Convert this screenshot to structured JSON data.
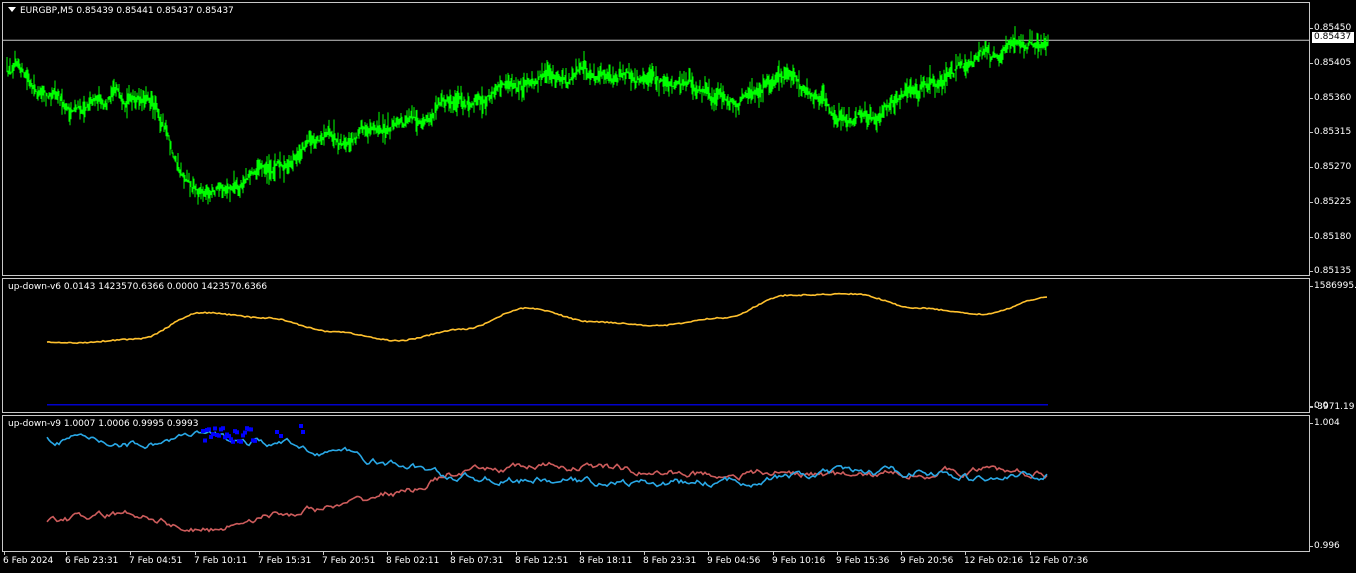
{
  "main_pane": {
    "symbol_label": "EURGBP,M5  0.85439 0.85441 0.85437 0.85437",
    "collapse_icon": "triangle-down-icon",
    "current_price_tag": "0.85437",
    "price_axis": [
      "0.85450",
      "0.85405",
      "0.85360",
      "0.85315",
      "0.85270",
      "0.85225",
      "0.85180",
      "0.85135"
    ],
    "colors": {
      "candles": "#00ff00",
      "price_line": "#c8c8c8"
    }
  },
  "indicator_1": {
    "label": "up-down-v6 0.0143 1423570.6366 0.0000 1423570.6366",
    "axis": [
      "1586995.0",
      "0.0",
      "-3971.19"
    ],
    "colors": {
      "line_main": "#ffc12e",
      "line_base": "#0000cc"
    }
  },
  "indicator_2": {
    "label": "up-down-v9 1.0007 1.0006 0.9995 0.9993",
    "axis": [
      "1.004",
      "0.996"
    ],
    "colors": {
      "line_blue": "#29a8e6",
      "line_red": "#cd5c5c",
      "markers": "#0000ff"
    }
  },
  "time_axis": [
    "6 Feb 2024",
    "6 Feb 23:31",
    "7 Feb 04:51",
    "7 Feb 10:11",
    "7 Feb 15:31",
    "7 Feb 20:51",
    "8 Feb 02:11",
    "8 Feb 07:31",
    "8 Feb 12:51",
    "8 Feb 18:11",
    "8 Feb 23:31",
    "9 Feb 04:56",
    "9 Feb 10:16",
    "9 Feb 15:36",
    "9 Feb 20:56",
    "12 Feb 02:16",
    "12 Feb 07:36"
  ],
  "chart_data": [
    {
      "type": "line",
      "title": "EURGBP,M5",
      "xlabel": "",
      "ylabel": "",
      "ylim": [
        0.85135,
        0.85465
      ],
      "x": [
        "6 Feb 2024",
        "6 Feb 23:31",
        "7 Feb 04:51",
        "7 Feb 10:11",
        "7 Feb 15:31",
        "7 Feb 20:51",
        "8 Feb 02:11",
        "8 Feb 07:31",
        "8 Feb 12:51",
        "8 Feb 18:11",
        "8 Feb 23:31",
        "9 Feb 04:56",
        "9 Feb 10:16",
        "9 Feb 15:36",
        "9 Feb 20:56",
        "12 Feb 02:16",
        "12 Feb 07:36"
      ],
      "series": [
        {
          "name": "",
          "values": [
            0.854,
            0.85345,
            0.8537,
            0.8523,
            0.85265,
            0.8531,
            0.85325,
            0.85355,
            0.8539,
            0.85395,
            0.85385,
            0.8536,
            0.8539,
            0.8533,
            0.8537,
            0.8542,
            0.85437
          ]
        }
      ]
    },
    {
      "type": "line",
      "title": "up-down-v6",
      "ylim": [
        -3971.19,
        1586995.0
      ],
      "x": [
        "6 Feb 2024",
        "6 Feb 23:31",
        "7 Feb 04:51",
        "7 Feb 10:11",
        "7 Feb 15:31",
        "7 Feb 20:51",
        "8 Feb 02:11",
        "8 Feb 07:31",
        "8 Feb 12:51",
        "8 Feb 18:11",
        "8 Feb 23:31",
        "9 Feb 04:56",
        "9 Feb 10:16",
        "9 Feb 15:36",
        "9 Feb 20:56",
        "12 Feb 02:16",
        "12 Feb 07:36"
      ],
      "series": [
        {
          "name": "",
          "values": [
            850000,
            820000,
            870000,
            1220000,
            1150000,
            970000,
            850000,
            1000000,
            1280000,
            1100000,
            1050000,
            1150000,
            1450000,
            1470000,
            1280000,
            1200000,
            1423570
          ]
        },
        {
          "name": "",
          "values": [
            0,
            0,
            0,
            0,
            0,
            0,
            0,
            0,
            0,
            0,
            0,
            0,
            0,
            0,
            0,
            0,
            0
          ]
        }
      ]
    },
    {
      "type": "line",
      "title": "up-down-v9",
      "ylim": [
        0.996,
        1.004
      ],
      "x": [
        "6 Feb 2024",
        "6 Feb 23:31",
        "7 Feb 04:51",
        "7 Feb 10:11",
        "7 Feb 15:31",
        "7 Feb 20:51",
        "8 Feb 02:11",
        "8 Feb 07:31",
        "8 Feb 12:51",
        "8 Feb 18:11",
        "8 Feb 23:31",
        "9 Feb 04:56",
        "9 Feb 10:16",
        "9 Feb 15:36",
        "9 Feb 20:56",
        "12 Feb 02:16",
        "12 Feb 07:36"
      ],
      "series": [
        {
          "name": "",
          "values": [
            1.0032,
            1.003,
            1.0027,
            1.0032,
            1.0027,
            1.0022,
            1.0013,
            1.0005,
            1.0003,
            1.0002,
            1.0001,
            1.0002,
            1.0005,
            1.0008,
            1.0009,
            1.0004,
            1.0006
          ]
        },
        {
          "name": "",
          "values": [
            0.9975,
            0.9978,
            0.9981,
            0.997,
            0.998,
            0.9985,
            0.9995,
            1.0008,
            1.0012,
            1.0012,
            1.0008,
            1.0007,
            1.0008,
            1.0006,
            1.0008,
            1.001,
            1.0007
          ]
        }
      ]
    }
  ]
}
